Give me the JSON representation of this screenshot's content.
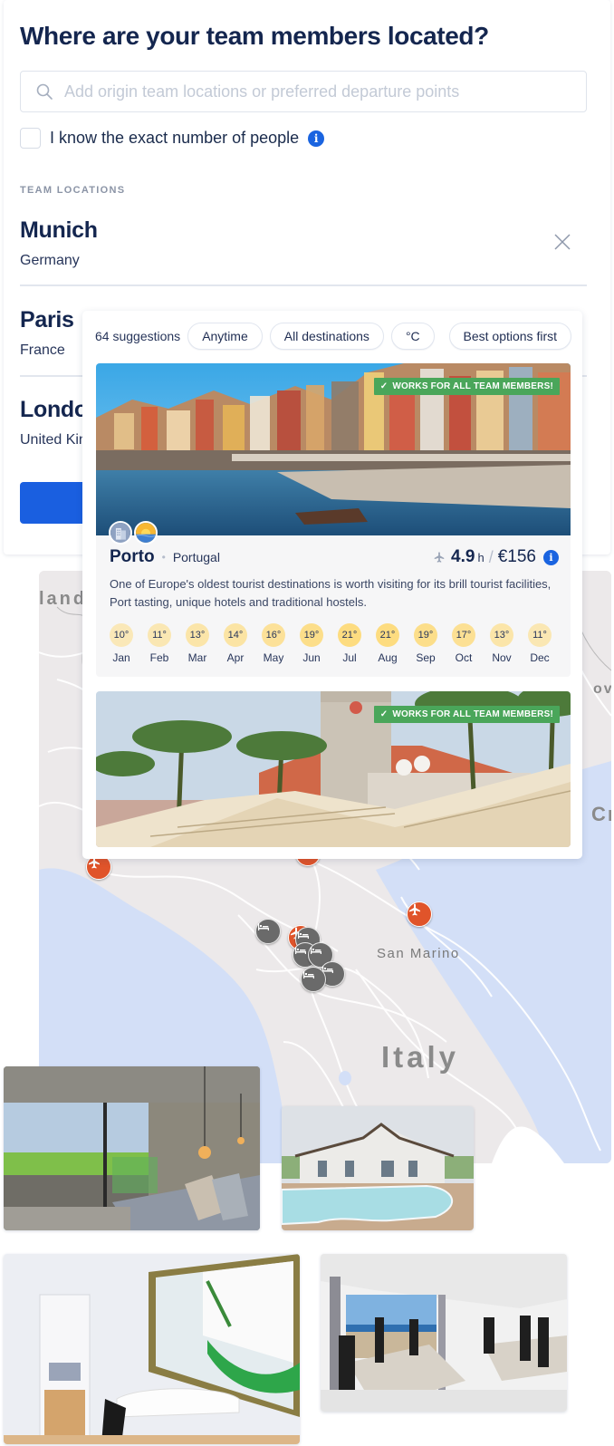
{
  "form": {
    "title": "Where are your team members located?",
    "search": {
      "placeholder": "Add origin team locations or preferred departure points",
      "value": ""
    },
    "exact_people_checkbox": {
      "label": "I know the exact number of people",
      "checked": false
    },
    "section_label": "TEAM LOCATIONS",
    "locations": [
      {
        "city": "Munich",
        "country": "Germany"
      },
      {
        "city": "Paris",
        "country": "France"
      },
      {
        "city": "London",
        "country": "United Kingdom"
      }
    ],
    "primary_button_label": ""
  },
  "suggestions": {
    "count_label": "64 suggestions",
    "filters": {
      "time": "Anytime",
      "destinations": "All destinations",
      "unit": "°C",
      "sort": "Best options first"
    },
    "cards": [
      {
        "name": "Porto",
        "country": "Portugal",
        "badge": "WORKS FOR ALL TEAM MEMBERS!",
        "type_icons": [
          "city-icon",
          "beach-sunset-icon"
        ],
        "flight_hours": "4.9",
        "flight_hours_unit": "h",
        "price": "€156",
        "description": "One of Europe's oldest tourist destinations is worth visiting for its brill tourist facilities, Port tasting, unique hotels and traditional hostels.",
        "climate": [
          {
            "month": "Jan",
            "temp": "10°",
            "value": 10
          },
          {
            "month": "Feb",
            "temp": "11°",
            "value": 11
          },
          {
            "month": "Mar",
            "temp": "13°",
            "value": 13
          },
          {
            "month": "Apr",
            "temp": "14°",
            "value": 14
          },
          {
            "month": "May",
            "temp": "16°",
            "value": 16
          },
          {
            "month": "Jun",
            "temp": "19°",
            "value": 19
          },
          {
            "month": "Jul",
            "temp": "21°",
            "value": 21
          },
          {
            "month": "Aug",
            "temp": "21°",
            "value": 21
          },
          {
            "month": "Sep",
            "temp": "19°",
            "value": 19
          },
          {
            "month": "Oct",
            "temp": "17°",
            "value": 17
          },
          {
            "month": "Nov",
            "temp": "13°",
            "value": 13
          },
          {
            "month": "Dec",
            "temp": "11°",
            "value": 11
          }
        ]
      },
      {
        "badge": "WORKS FOR ALL TEAM MEMBERS!"
      }
    ]
  },
  "map": {
    "labels": {
      "land": "land",
      "ov": "ov",
      "cro": "Cr",
      "san_marino": "San Marino",
      "italy": "Italy"
    }
  },
  "colors": {
    "primary": "#1a5fe0",
    "heading": "#14264f",
    "badge_green": "#4aa65a",
    "airport_pin": "#e0542a",
    "hotel_pin": "#6a6a6a",
    "map_water": "#d3dff7",
    "map_land": "#ece9ea"
  }
}
